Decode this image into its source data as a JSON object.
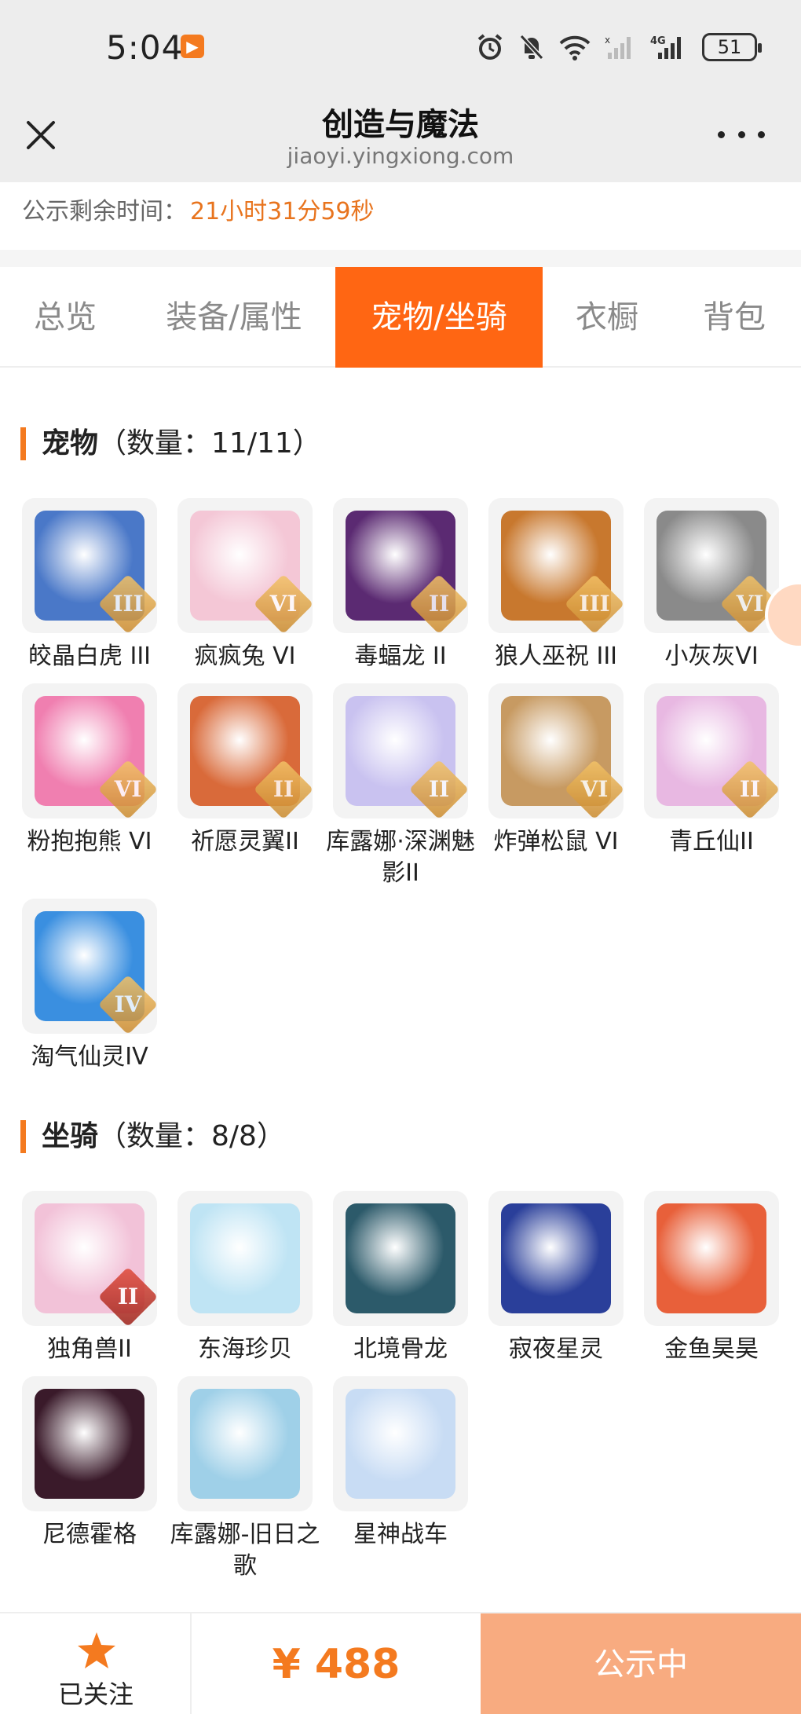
{
  "status_bar": {
    "time": "5:04",
    "battery": "51",
    "network": "4G"
  },
  "header": {
    "title": "创造与魔法",
    "subtitle": "jiaoyi.yingxiong.com"
  },
  "countdown": {
    "label": "公示剩余时间：",
    "value": "21小时31分59秒"
  },
  "tabs": [
    {
      "label": "总览",
      "active": false
    },
    {
      "label": "装备/属性",
      "active": false
    },
    {
      "label": "宠物/坐骑",
      "active": true
    },
    {
      "label": "衣橱",
      "active": false
    },
    {
      "label": "背包",
      "active": false
    }
  ],
  "pets": {
    "title": "宠物",
    "count": "（数量：11/11）",
    "items": [
      {
        "name": "皎晶白虎 III",
        "rank": "III",
        "icon": "white-tiger-icon",
        "color": "#4a78c8"
      },
      {
        "name": "疯疯兔 VI",
        "rank": "VI",
        "icon": "crazy-rabbit-icon",
        "color": "#f4c7d6"
      },
      {
        "name": "毒蝠龙 II",
        "rank": "II",
        "icon": "poison-bat-dragon-icon",
        "color": "#5b2a72"
      },
      {
        "name": "狼人巫祝 III",
        "rank": "III",
        "icon": "werewolf-shaman-icon",
        "color": "#c8782e"
      },
      {
        "name": "小灰灰VI",
        "rank": "VI",
        "icon": "little-grey-wolf-icon",
        "color": "#8a8a8a"
      },
      {
        "name": "粉抱抱熊 VI",
        "rank": "VI",
        "icon": "pink-hug-bear-icon",
        "color": "#f07fb0"
      },
      {
        "name": "祈愿灵翼II",
        "rank": "II",
        "icon": "wish-spirit-wing-icon",
        "color": "#d96a3a"
      },
      {
        "name": "库露娜·深渊魅影II",
        "rank": "II",
        "icon": "kuluna-abyss-icon",
        "color": "#c9c2f0"
      },
      {
        "name": "炸弹松鼠 VI",
        "rank": "VI",
        "icon": "bomb-squirrel-icon",
        "color": "#c79a62"
      },
      {
        "name": "青丘仙II",
        "rank": "II",
        "icon": "qingqiu-fairy-icon",
        "color": "#e8b8e2"
      },
      {
        "name": "淘气仙灵IV",
        "rank": "IV",
        "icon": "naughty-sprite-icon",
        "color": "#3a8fe0"
      }
    ]
  },
  "mounts": {
    "title": "坐骑",
    "count": "（数量：8/8）",
    "items": [
      {
        "name": "独角兽II",
        "rank": "II",
        "icon": "unicorn-icon",
        "color": "#f2c2d8"
      },
      {
        "name": "东海珍贝",
        "rank": "",
        "icon": "pearl-shell-icon",
        "color": "#bfe4f4"
      },
      {
        "name": "北境骨龙",
        "rank": "",
        "icon": "bone-dragon-icon",
        "color": "#2c5a6a"
      },
      {
        "name": "寂夜星灵",
        "rank": "",
        "icon": "night-star-spirit-icon",
        "color": "#2a3f9a"
      },
      {
        "name": "金鱼昊昊",
        "rank": "",
        "icon": "goldfish-icon",
        "color": "#e8603a"
      },
      {
        "name": "尼德霍格",
        "rank": "",
        "icon": "nidhogg-icon",
        "color": "#3a1a2a"
      },
      {
        "name": "库露娜-旧日之歌",
        "rank": "",
        "icon": "kuluna-song-icon",
        "color": "#9fd0e8"
      },
      {
        "name": "星神战车",
        "rank": "",
        "icon": "star-chariot-icon",
        "color": "#c8dcf4"
      }
    ]
  },
  "bottom_bar": {
    "follow_label": "已关注",
    "price": "¥ 488",
    "status_label": "公示中"
  },
  "colors": {
    "accent": "#ff6613",
    "price": "#f47a1f",
    "status_button": "#f8ab80"
  }
}
